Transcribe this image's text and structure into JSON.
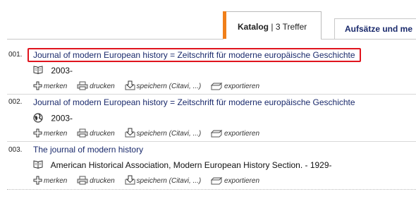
{
  "tabs": {
    "active": {
      "label": "Katalog",
      "separator": "|",
      "count": "3 Treffer"
    },
    "inactive": {
      "label": "Aufsätze und me"
    }
  },
  "actions": {
    "bookmark": "merken",
    "print": "drucken",
    "save": "speichern (Citavi, ...)",
    "export": "exportieren"
  },
  "results": [
    {
      "number": "001.",
      "title": "Journal of modern European history = Zeitschrift für moderne europäische Geschichte",
      "detail": "2003-",
      "media_icon": "journal-icon",
      "highlighted": true
    },
    {
      "number": "002.",
      "title": "Journal of modern European history = Zeitschrift für moderne europäische Geschichte",
      "detail": "2003-",
      "media_icon": "online-resource-icon",
      "highlighted": false
    },
    {
      "number": "003.",
      "title": "The journal of modern history",
      "detail": "American Historical Association, Modern European History Section. - 1929-",
      "media_icon": "journal-icon",
      "highlighted": false
    }
  ],
  "colors": {
    "link": "#1a2a6c",
    "accent": "#f07f1a",
    "highlight": "#e0141e"
  }
}
